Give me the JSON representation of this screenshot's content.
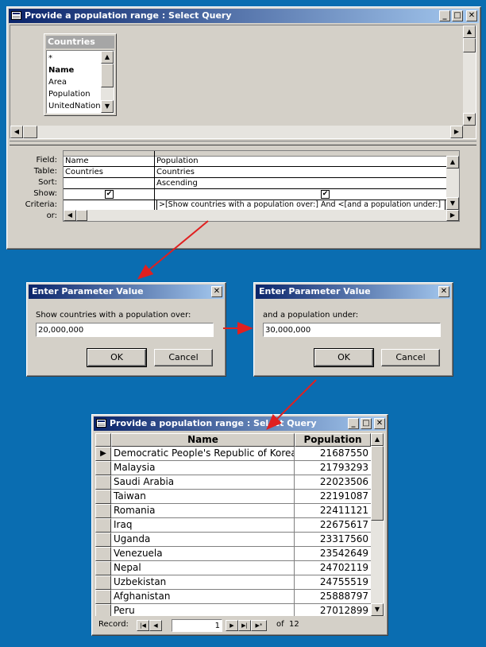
{
  "query_window": {
    "title": "Provide a population range : Select Query",
    "table": {
      "name": "Countries",
      "fields": [
        {
          "label": "*",
          "bold": false
        },
        {
          "label": "Name",
          "bold": true
        },
        {
          "label": "Area",
          "bold": false
        },
        {
          "label": "Population",
          "bold": false
        },
        {
          "label": "UnitedNations",
          "bold": false
        }
      ]
    },
    "grid": {
      "row_labels": {
        "field": "Field:",
        "table": "Table:",
        "sort": "Sort:",
        "show": "Show:",
        "criteria": "Criteria:",
        "or": "or:"
      },
      "columns": [
        {
          "field": "Name",
          "table": "Countries",
          "sort": "",
          "show": "✔",
          "criteria": ""
        },
        {
          "field": "Population",
          "table": "Countries",
          "sort": "Ascending",
          "show": "✔",
          "criteria": ">[Show countries with a population over:] And <[and a population under:]"
        }
      ]
    }
  },
  "dialog1": {
    "title": "Enter Parameter Value",
    "prompt": "Show countries with a population over:",
    "value": "20,000,000",
    "ok": "OK",
    "cancel": "Cancel"
  },
  "dialog2": {
    "title": "Enter Parameter Value",
    "prompt": "and a population under:",
    "value": "30,000,000",
    "ok": "OK",
    "cancel": "Cancel"
  },
  "results_window": {
    "title": "Provide a population range : Select Query",
    "columns": [
      "Name",
      "Population"
    ],
    "rows": [
      {
        "name": "Democratic People's Republic of Korea",
        "population": "21687550"
      },
      {
        "name": "Malaysia",
        "population": "21793293"
      },
      {
        "name": "Saudi Arabia",
        "population": "22023506"
      },
      {
        "name": "Taiwan",
        "population": "22191087"
      },
      {
        "name": "Romania",
        "population": "22411121"
      },
      {
        "name": "Iraq",
        "population": "22675617"
      },
      {
        "name": "Uganda",
        "population": "23317560"
      },
      {
        "name": "Venezuela",
        "population": "23542649"
      },
      {
        "name": "Nepal",
        "population": "24702119"
      },
      {
        "name": "Uzbekistan",
        "population": "24755519"
      },
      {
        "name": "Afghanistan",
        "population": "25888797"
      },
      {
        "name": "Peru",
        "population": "27012899"
      }
    ],
    "record_nav": {
      "label": "Record:",
      "current": "1",
      "of_label": "of",
      "total": "12"
    }
  },
  "icons": {
    "minimize": "minimize-icon",
    "maximize": "maximize-icon",
    "close": "close-icon"
  }
}
